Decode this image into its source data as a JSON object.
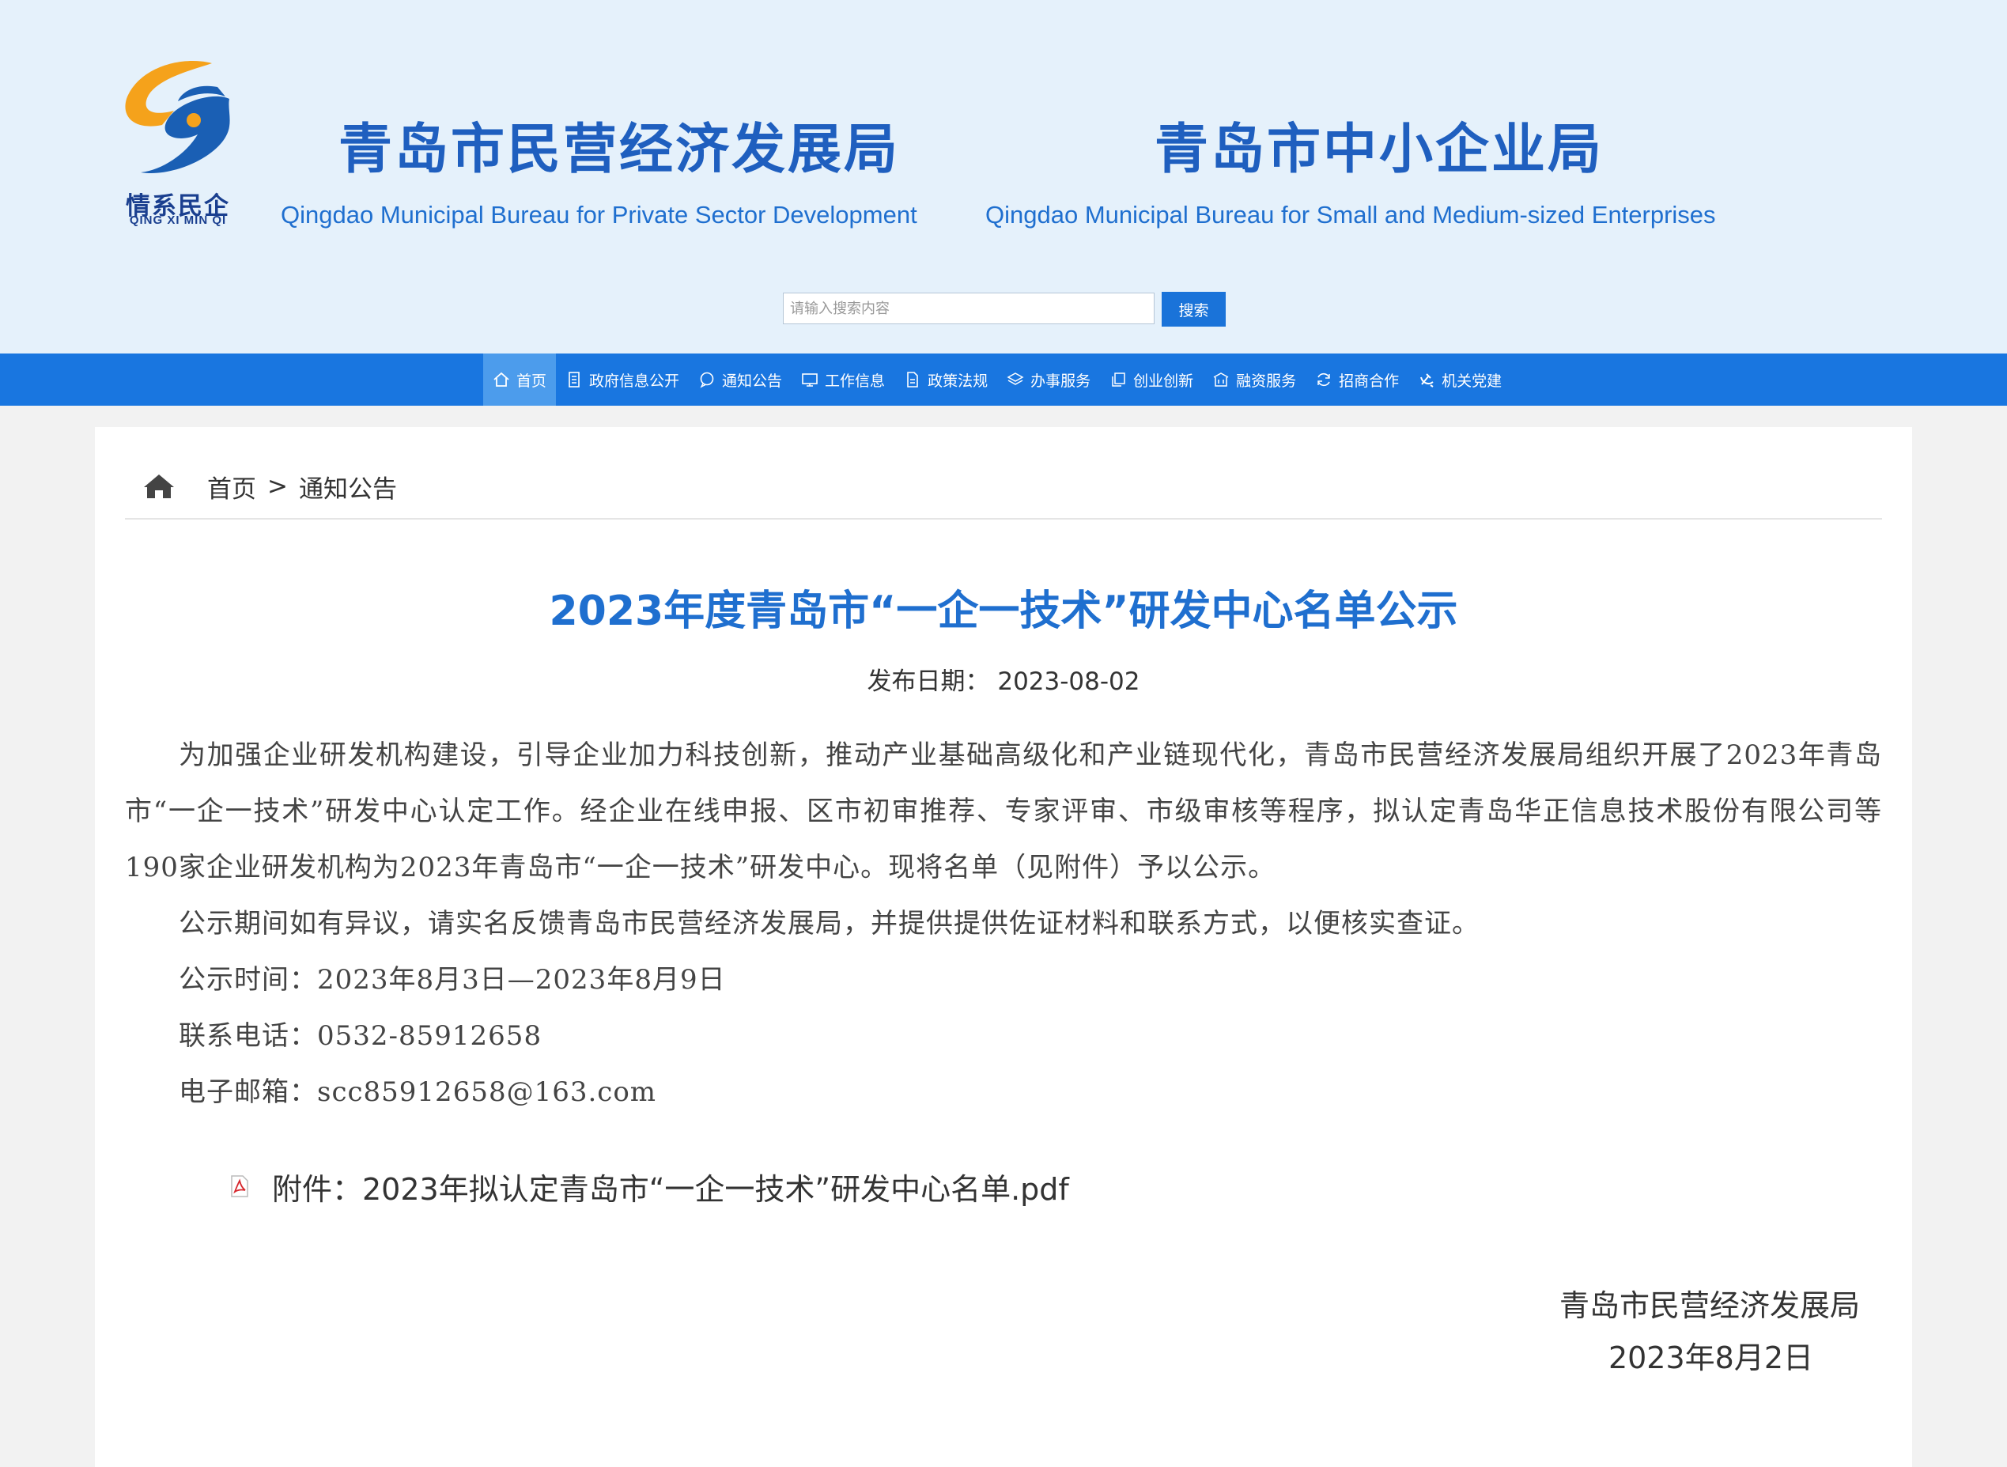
{
  "header": {
    "logo_text_cn": "情系民企",
    "logo_text_en": "QING XI MIN QI",
    "title_left_cn": "青岛市民营经济发展局",
    "title_left_en": "Qingdao Municipal Bureau for Private Sector Development",
    "title_right_cn": "青岛市中小企业局",
    "title_right_en": "Qingdao Municipal Bureau for Small and Medium-sized Enterprises",
    "colors": {
      "title": "#1f5fbf",
      "logo_orange": "#f5a21b",
      "logo_blue": "#1a5fb4"
    }
  },
  "search": {
    "placeholder": "请输入搜索内容",
    "button_label": "搜索"
  },
  "nav": {
    "items": [
      {
        "label": "首页",
        "icon": "home-icon"
      },
      {
        "label": "政府信息公开",
        "icon": "document-icon"
      },
      {
        "label": "通知公告",
        "icon": "chat-icon"
      },
      {
        "label": "工作信息",
        "icon": "monitor-icon"
      },
      {
        "label": "政策法规",
        "icon": "file-icon"
      },
      {
        "label": "办事服务",
        "icon": "layers-icon"
      },
      {
        "label": "创业创新",
        "icon": "copy-icon"
      },
      {
        "label": "融资服务",
        "icon": "building-icon"
      },
      {
        "label": "招商合作",
        "icon": "refresh-icon"
      },
      {
        "label": "机关党建",
        "icon": "party-icon"
      }
    ],
    "colors": {
      "bar": "#1976e0",
      "active": "#4c9cec"
    }
  },
  "breadcrumb": {
    "home": "首页",
    "separator": ">",
    "current": "通知公告"
  },
  "article": {
    "title": "2023年度青岛市“一企一技术”研发中心名单公示",
    "date_label": "发布日期：",
    "date": "2023-08-02",
    "paragraphs": [
      "为加强企业研发机构建设，引导企业加力科技创新，推动产业基础高级化和产业链现代化，青岛市民营经济发展局组织开展了2023年青岛市“一企一技术”研发中心认定工作。经企业在线申报、区市初审推荐、专家评审、市级审核等程序，拟认定青岛华正信息技术股份有限公司等190家企业研发机构为2023年青岛市“一企一技术”研发中心。现将名单（见附件）予以公示。",
      "公示期间如有异议，请实名反馈青岛市民营经济发展局，并提供提供佐证材料和联系方式，以便核实查证。",
      "公示时间：2023年8月3日—2023年8月9日",
      "联系电话：0532-85912658",
      "电子邮箱：scc85912658@163.com"
    ],
    "attachment": "附件：2023年拟认定青岛市“一企一技术”研发中心名单.pdf",
    "signature_org": "青岛市民营经济发展局",
    "signature_date": "2023年8月2日"
  }
}
